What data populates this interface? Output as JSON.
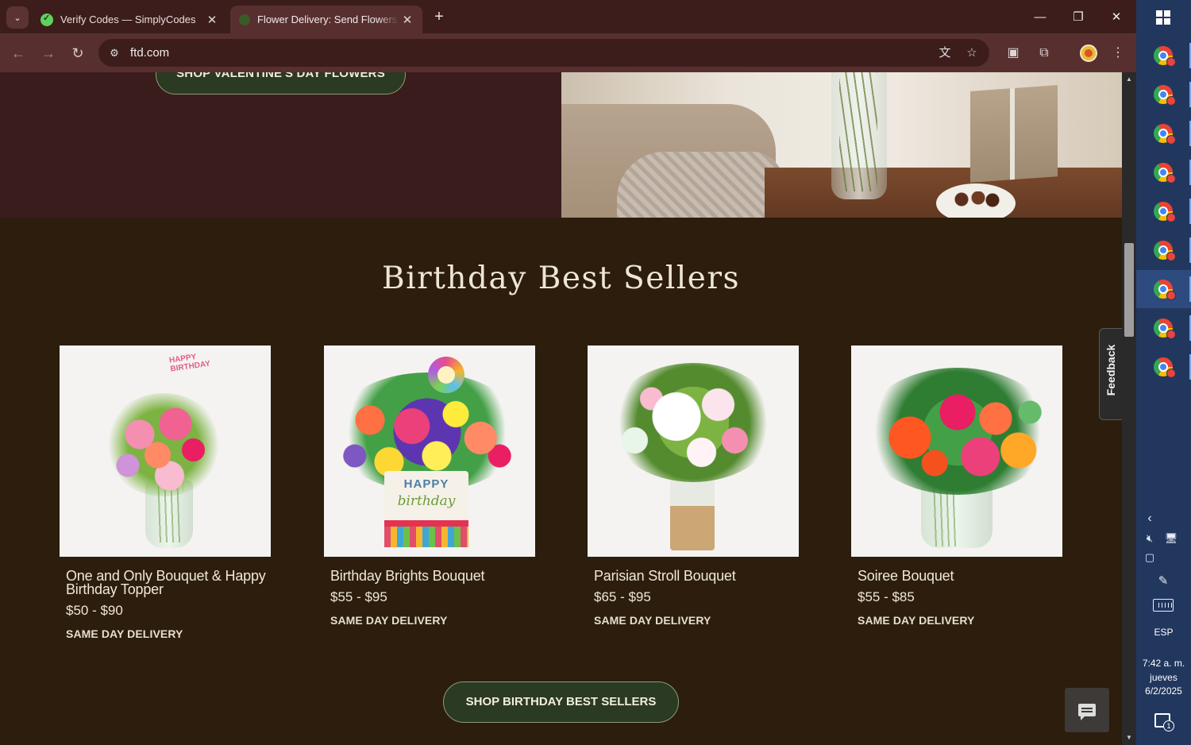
{
  "browser": {
    "tabs": [
      {
        "title": "Verify Codes — SimplyCodes",
        "active": false
      },
      {
        "title": "Flower Delivery: Send Flowers Online",
        "active": true
      }
    ],
    "url": "ftd.com",
    "icons": [
      "tab-search-icon",
      "close-icon",
      "new-tab-icon",
      "minimize-icon",
      "restore-icon",
      "back-icon",
      "forward-icon",
      "reload-icon",
      "site-info-icon",
      "translate-icon",
      "bookmark-star-icon",
      "extension-icon",
      "puzzle-icon",
      "profile-avatar",
      "kebab-menu-icon"
    ]
  },
  "hero": {
    "button_label": "SHOP VALENTINE'S DAY FLOWERS"
  },
  "section": {
    "title": "Birthday Best Sellers",
    "products": [
      {
        "name": "One and Only Bouquet & Happy Birthday Topper",
        "price": "$50 - $90",
        "delivery": "SAME DAY DELIVERY",
        "topper": "HAPPY BIRTHDAY"
      },
      {
        "name": "Birthday Brights Bouquet",
        "price": "$55 - $95",
        "delivery": "SAME DAY DELIVERY",
        "box_line1": "HAPPY",
        "box_line2": "birthday"
      },
      {
        "name": "Parisian Stroll Bouquet",
        "price": "$65 - $95",
        "delivery": "SAME DAY DELIVERY"
      },
      {
        "name": "Soiree Bouquet",
        "price": "$55 - $85",
        "delivery": "SAME DAY DELIVERY"
      }
    ],
    "shop_button": "SHOP BIRTHDAY BEST SELLERS"
  },
  "feedback": {
    "label": "Feedback"
  },
  "chat": {
    "icon": "chat-icon"
  },
  "taskbar": {
    "language": "ESP",
    "time": "7:42 a. m.",
    "day": "jueves",
    "date": "6/2/2025",
    "notification_count": "1",
    "app_count": 9,
    "active_app_index": 6
  },
  "colors": {
    "page_bg": "#2c1d0d",
    "hero_bg": "#3a1c1d",
    "button_bg": "#2b3a22",
    "chrome_bg": "#582f2f",
    "taskbar_bg": "#22375e"
  }
}
